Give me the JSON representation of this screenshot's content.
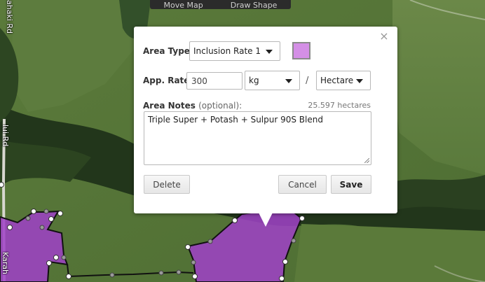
{
  "toolbar": {
    "move_map_label": "Move Map",
    "draw_shape_label": "Draw Shape"
  },
  "map": {
    "road_labels": [
      "ahaki Rd",
      "lui Rd",
      "Karah"
    ],
    "polygon_color": "#a041c8"
  },
  "popup": {
    "area_type_label": "Area Type:",
    "area_type_value": "Inclusion Rate 1",
    "area_color": "#d48fe6",
    "app_rate_label": "App. Rate:",
    "app_rate_value": "300",
    "unit_value": "kg",
    "divider": "/",
    "per_unit_value": "Hectare",
    "area_notes_label": "Area Notes",
    "area_notes_optional": "(optional):",
    "area_size": "25.597 hectares",
    "area_notes_value": "Triple Super + Potash + Sulpur 90S Blend",
    "delete_label": "Delete",
    "cancel_label": "Cancel",
    "save_label": "Save",
    "close_symbol": "×"
  }
}
